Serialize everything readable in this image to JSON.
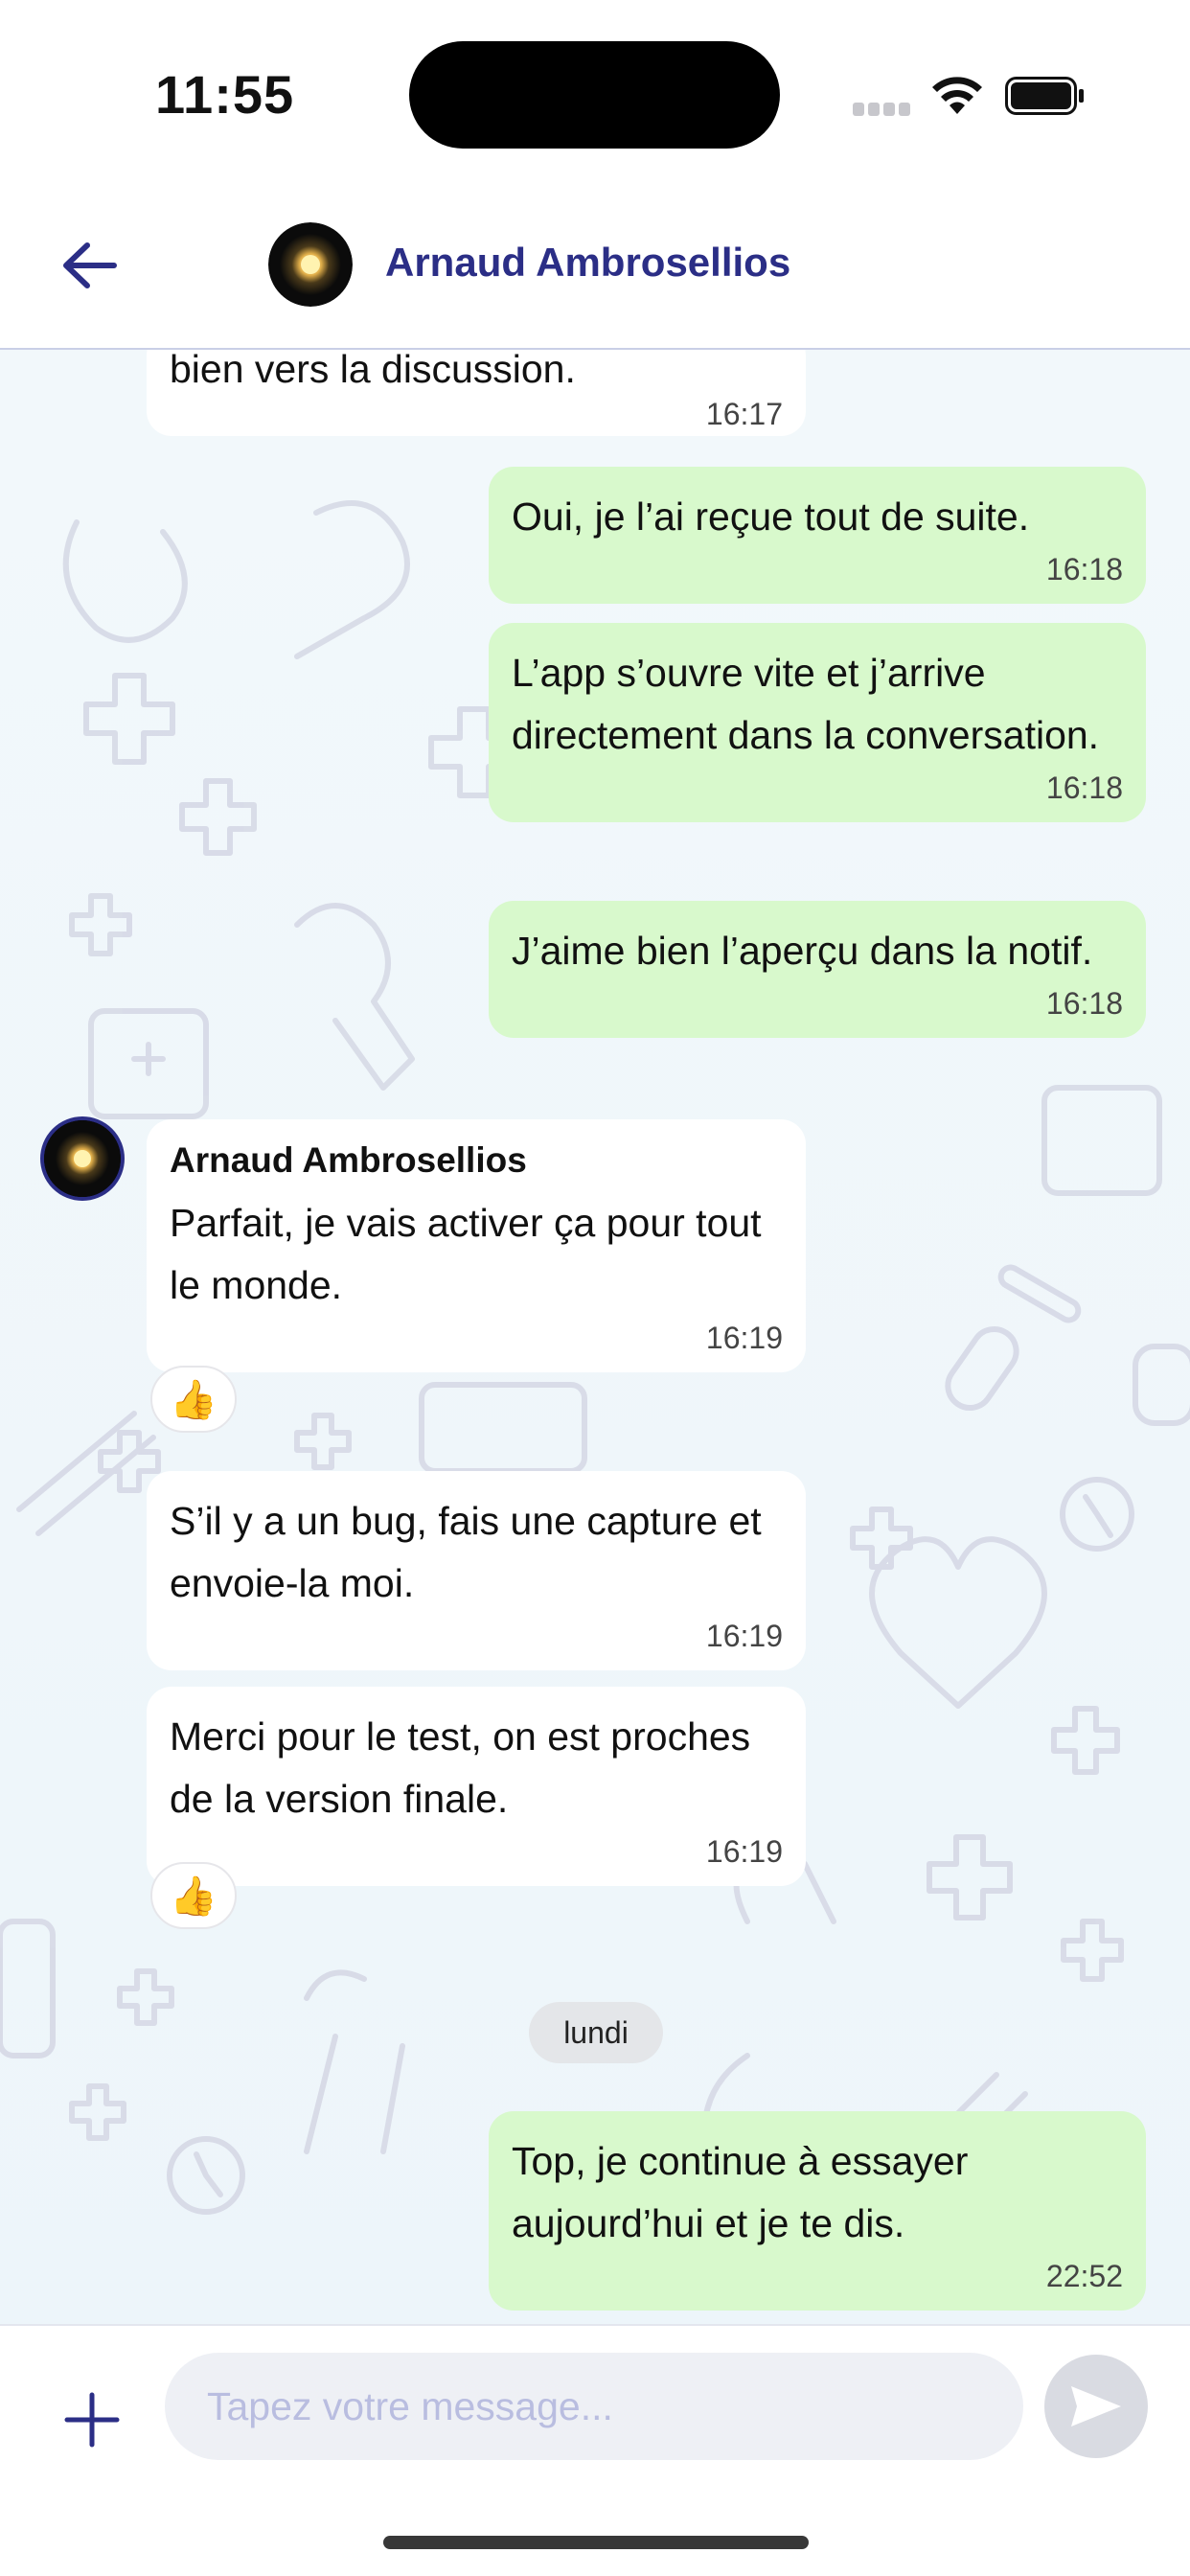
{
  "status_bar": {
    "time": "11:55"
  },
  "header": {
    "contact_name": "Arnaud Ambrosellios",
    "back_icon": "arrow-left-icon",
    "accent_color": "#2b2e86"
  },
  "messages": [
    {
      "direction": "in",
      "text": "bien vers la discussion.",
      "time": "16:17"
    },
    {
      "direction": "out",
      "text": "Oui, je l’ai reçue tout de suite.",
      "time": "16:18"
    },
    {
      "direction": "out",
      "text": "L’app s’ouvre vite et j’arrive directement dans la conversation.",
      "time": "16:18"
    },
    {
      "direction": "out",
      "text": "J’aime bien l’aperçu dans la notif.",
      "time": "16:18"
    },
    {
      "direction": "in",
      "sender": "Arnaud Ambrosellios",
      "text": "Parfait, je vais activer ça pour tout le monde.",
      "time": "16:19",
      "reaction": "👍"
    },
    {
      "direction": "in",
      "text": "S’il y a un bug, fais une capture et envoie-la moi.",
      "time": "16:19"
    },
    {
      "direction": "in",
      "text": "Merci pour le test, on est proches de la version finale.",
      "time": "16:19",
      "reaction": "👍"
    },
    {
      "direction": "out",
      "text": "Top, je continue à essayer aujourd’hui et je te dis.",
      "time": "22:52"
    }
  ],
  "day_separator": "lundi",
  "composer": {
    "placeholder": "Tapez votre message...",
    "plus_icon": "plus-icon",
    "send_icon": "send-icon"
  },
  "colors": {
    "outgoing_bubble": "#d8f9cc",
    "incoming_bubble": "#ffffff",
    "chat_background": "#eef6fa"
  }
}
